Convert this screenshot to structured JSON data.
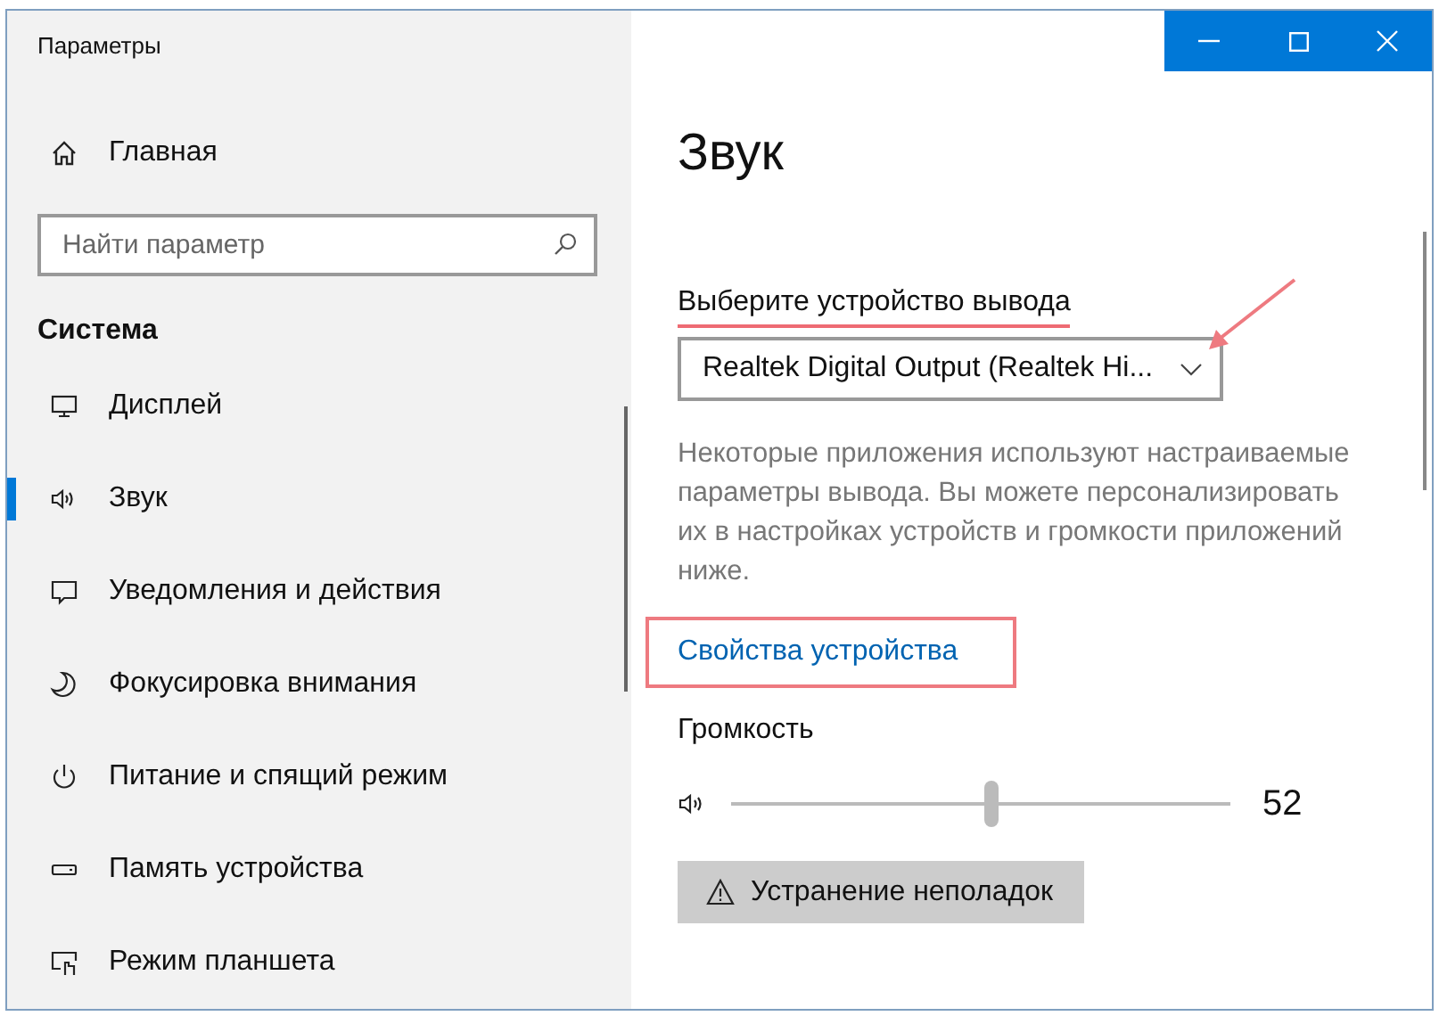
{
  "window": {
    "title": "Параметры"
  },
  "sidebar": {
    "home": {
      "label": "Главная"
    },
    "search": {
      "placeholder": "Найти параметр"
    },
    "section": "Система",
    "items": [
      {
        "label": "Дисплей",
        "kind": "display",
        "selected": false
      },
      {
        "label": "Звук",
        "kind": "sound",
        "selected": true
      },
      {
        "label": "Уведомления и действия",
        "kind": "notifications",
        "selected": false
      },
      {
        "label": "Фокусировка внимания",
        "kind": "focus",
        "selected": false
      },
      {
        "label": "Питание и спящий режим",
        "kind": "power",
        "selected": false
      },
      {
        "label": "Память устройства",
        "kind": "storage",
        "selected": false
      },
      {
        "label": "Режим планшета",
        "kind": "tablet",
        "selected": false
      }
    ]
  },
  "page": {
    "title": "Звук",
    "output_label": "Выберите устройство вывода",
    "output_device": "Realtek Digital Output (Realtek Hi...",
    "description": "Некоторые приложения используют настраиваемые параметры вывода. Вы можете персонализировать их в настройках устройств и громкости приложений ниже.",
    "device_properties_link": "Свойства устройства",
    "volume": {
      "label": "Громкость",
      "level": 0.52,
      "reading": "52"
    },
    "troubleshoot_button": "Устранение неполадок"
  }
}
